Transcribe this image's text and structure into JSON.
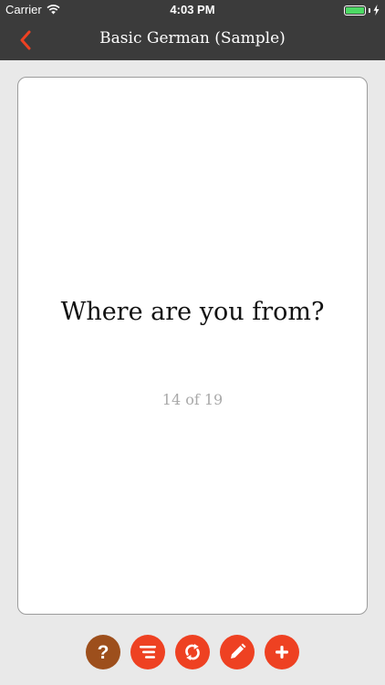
{
  "status_bar": {
    "carrier": "Carrier",
    "time": "4:03 PM",
    "battery_level": 1.0
  },
  "nav": {
    "back_icon": "chevron-left-icon",
    "title": "Basic German (Sample)"
  },
  "card": {
    "question": "Where are you from?",
    "counter": "14 of 19"
  },
  "toolbar": {
    "buttons": [
      {
        "icon": "help-icon",
        "glyph": "?",
        "color": "#9d4f1c"
      },
      {
        "icon": "sort-icon",
        "color": "#ee4122"
      },
      {
        "icon": "flip-icon",
        "color": "#ee4122"
      },
      {
        "icon": "edit-icon",
        "color": "#ee4122"
      },
      {
        "icon": "add-icon",
        "color": "#ee4122"
      }
    ]
  },
  "colors": {
    "accent": "#ee4122",
    "nav_background": "#3b3b3b",
    "page_background": "#e9e9e9",
    "battery": "#4cd964"
  }
}
